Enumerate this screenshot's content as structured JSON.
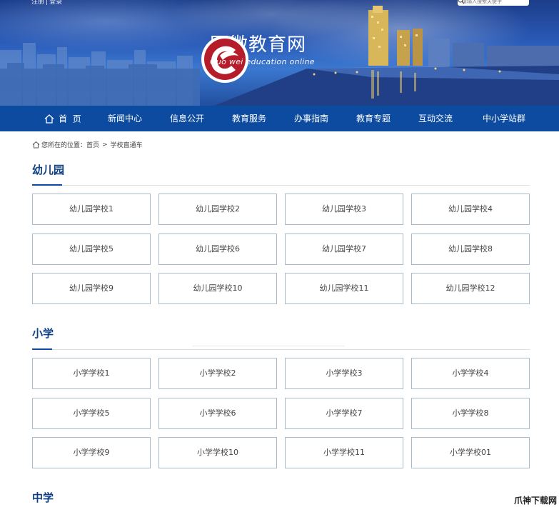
{
  "top_links": {
    "register": "注册",
    "separator": "|",
    "login": "登录"
  },
  "search": {
    "placeholder": "请输入搜索关键字"
  },
  "logo": {
    "title_cn": "国微教育网",
    "title_en": "Guo wei education online"
  },
  "nav": [
    {
      "label": "首  页",
      "icon": "home-icon"
    },
    {
      "label": "新闻中心"
    },
    {
      "label": "信息公开"
    },
    {
      "label": "教育服务"
    },
    {
      "label": "办事指南"
    },
    {
      "label": "教育专题"
    },
    {
      "label": "互动交流"
    },
    {
      "label": "中小学站群"
    }
  ],
  "breadcrumb": {
    "prefix": "您所在的位置：",
    "home": "首页",
    "separator": ">",
    "current": "学校直通车"
  },
  "sections": [
    {
      "title": "幼儿园",
      "items": [
        "幼儿园学校1",
        "幼儿园学校2",
        "幼儿园学校3",
        "幼儿园学校4",
        "幼儿园学校5",
        "幼儿园学校6",
        "幼儿园学校7",
        "幼儿园学校8",
        "幼儿园学校9",
        "幼儿园学校10",
        "幼儿园学校11",
        "幼儿园学校12"
      ]
    },
    {
      "title": "小学",
      "items": [
        "小学学校1",
        "小学学校2",
        "小学学校3",
        "小学学校4",
        "小学学校5",
        "小学学校6",
        "小学学校7",
        "小学学校8",
        "小学学校9",
        "小学学校10",
        "小学学校11",
        "小学学校01"
      ]
    },
    {
      "title": "中学",
      "items": []
    }
  ],
  "watermark": "爪神下载网",
  "colors": {
    "nav_bg": "#0c4ba0",
    "section_title": "#0c3e85",
    "button_border": "#a9b9cc",
    "logo_red": "#b51d2a"
  }
}
